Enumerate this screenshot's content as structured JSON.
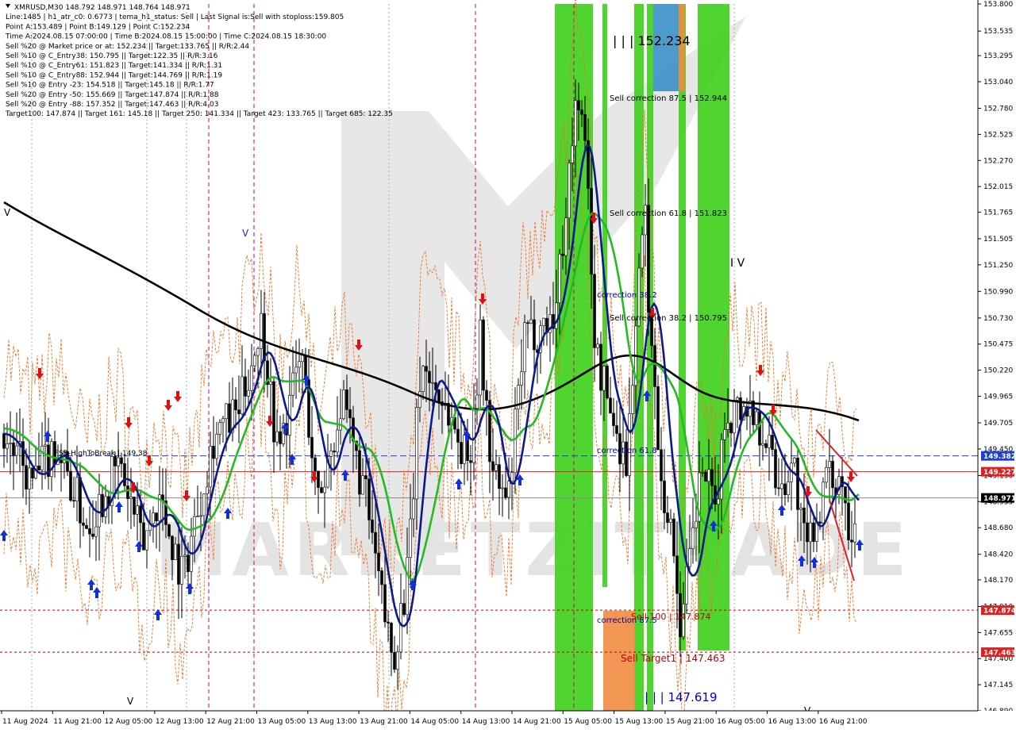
{
  "header": {
    "lines": [
      "XMRUSD,M30  148.792 148.971 148.764 148.971",
      "Line:1485 | h1_atr_c0: 0.6773 | tema_h1_status: Sell | Last Signal is:Sell with stoploss:159.805",
      "Point A:153.489 | Point B:149.129 | Point C:152.234",
      "Time A:2024.08.15 07:00:00 | Time B:2024.08.15 15:00:00 | Time C:2024.08.15 18:30:00",
      "Sell %20 @ Market price or at: 152.234 || Target:133.765 || R/R:2.44",
      "Sell %10 @ C_Entry38: 150.795 || Target:122.35 || R/R:3.16",
      "Sell %10 @ C_Entry61: 151.823 || Target:141.334 || R/R:1.31",
      "Sell %10 @ C_Entry88: 152.944 || Target:144.769 || R/R:1.19",
      "Sell %10 @ Entry -23: 154.518 || Target:145.18 || R/R:1.77",
      "Sell %20 @ Entry -50: 155.669 || Target:147.874 || R/R:1.88",
      "Sell %20 @ Entry -88: 157.352 || Target:147.463 || R/R:4.03",
      "Target100: 147.874 || Target 161: 145.18 || Target 250: 141.334 || Target 423: 133.765 || Target 685: 122.35"
    ]
  },
  "watermark": "MARKETZITRADE",
  "chart_data": {
    "type": "candlestick",
    "symbol": "XMRUSD",
    "timeframe": "M30",
    "ylim": [
      146.89,
      153.8
    ],
    "y_ticks": [
      "153.800",
      "153.535",
      "153.295",
      "153.040",
      "152.780",
      "152.525",
      "152.270",
      "152.015",
      "151.765",
      "151.505",
      "151.250",
      "150.990",
      "150.730",
      "150.475",
      "150.220",
      "149.965",
      "149.705",
      "149.450",
      "149.190",
      "148.935",
      "148.680",
      "148.420",
      "148.170",
      "147.910",
      "147.655",
      "147.400",
      "147.145",
      "146.890"
    ],
    "x_ticks": [
      "11 Aug 2024",
      "11 Aug 21:00",
      "12 Aug 05:00",
      "12 Aug 13:00",
      "12 Aug 21:00",
      "13 Aug 05:00",
      "13 Aug 13:00",
      "13 Aug 21:00",
      "14 Aug 05:00",
      "14 Aug 13:00",
      "14 Aug 21:00",
      "15 Aug 05:00",
      "15 Aug 13:00",
      "15 Aug 21:00",
      "16 Aug 05:00",
      "16 Aug 13:00",
      "16 Aug 21:00"
    ],
    "price_labels": [
      {
        "text": "149.382",
        "value": 149.382,
        "color": "#1c3fd6"
      },
      {
        "text": "149.227",
        "value": 149.227,
        "color": "#e02020"
      },
      {
        "text": "148.971",
        "value": 148.971,
        "color": "#000000"
      },
      {
        "text": "147.874",
        "value": 147.874,
        "color": "#e02020"
      },
      {
        "text": "147.463",
        "value": 147.463,
        "color": "#e02020"
      }
    ],
    "annotations": [
      {
        "text": "| | | 152.234",
        "color": "#000000"
      },
      {
        "text": "Sell correction 87.5 | 152.944",
        "color": "#000000"
      },
      {
        "text": "Sell correction 61.8 | 151.823",
        "color": "#000000"
      },
      {
        "text": "correction 38.2",
        "color": "#0000a0"
      },
      {
        "text": "Sell correction 38.2 | 150.795",
        "color": "#000000"
      },
      {
        "text": "correction 61.8",
        "color": "#0000a0"
      },
      {
        "text": "correction 87.5",
        "color": "#0000a0"
      },
      {
        "text": "Sell 100 | 147.874",
        "color": "#c00000"
      },
      {
        "text": "Sell Target1 | 147.463",
        "color": "#c00000"
      },
      {
        "text": "| | | 147.619",
        "color": "#0000c0"
      },
      {
        "text": "FSB-HighToBreak | 149.38",
        "color": "#000000"
      },
      {
        "text": "I V",
        "color": "#000000"
      },
      {
        "text": "V",
        "color": "#000000"
      }
    ],
    "series": [
      {
        "name": "ma200",
        "color": "#000000"
      },
      {
        "name": "ma-green",
        "color": "#22bb22"
      },
      {
        "name": "ma-navy",
        "color": "#0a1a8c"
      }
    ],
    "grid": false,
    "colors": {
      "bull": "#ffffff",
      "bear": "#000000",
      "green_zone": "#3ccf1a",
      "blue_zone": "#3a8fc8",
      "orange_zone": "#f08c40",
      "magenta_line": "#cc0066",
      "blue_dash": "#1c3fd6",
      "red_line": "#e02020"
    }
  }
}
